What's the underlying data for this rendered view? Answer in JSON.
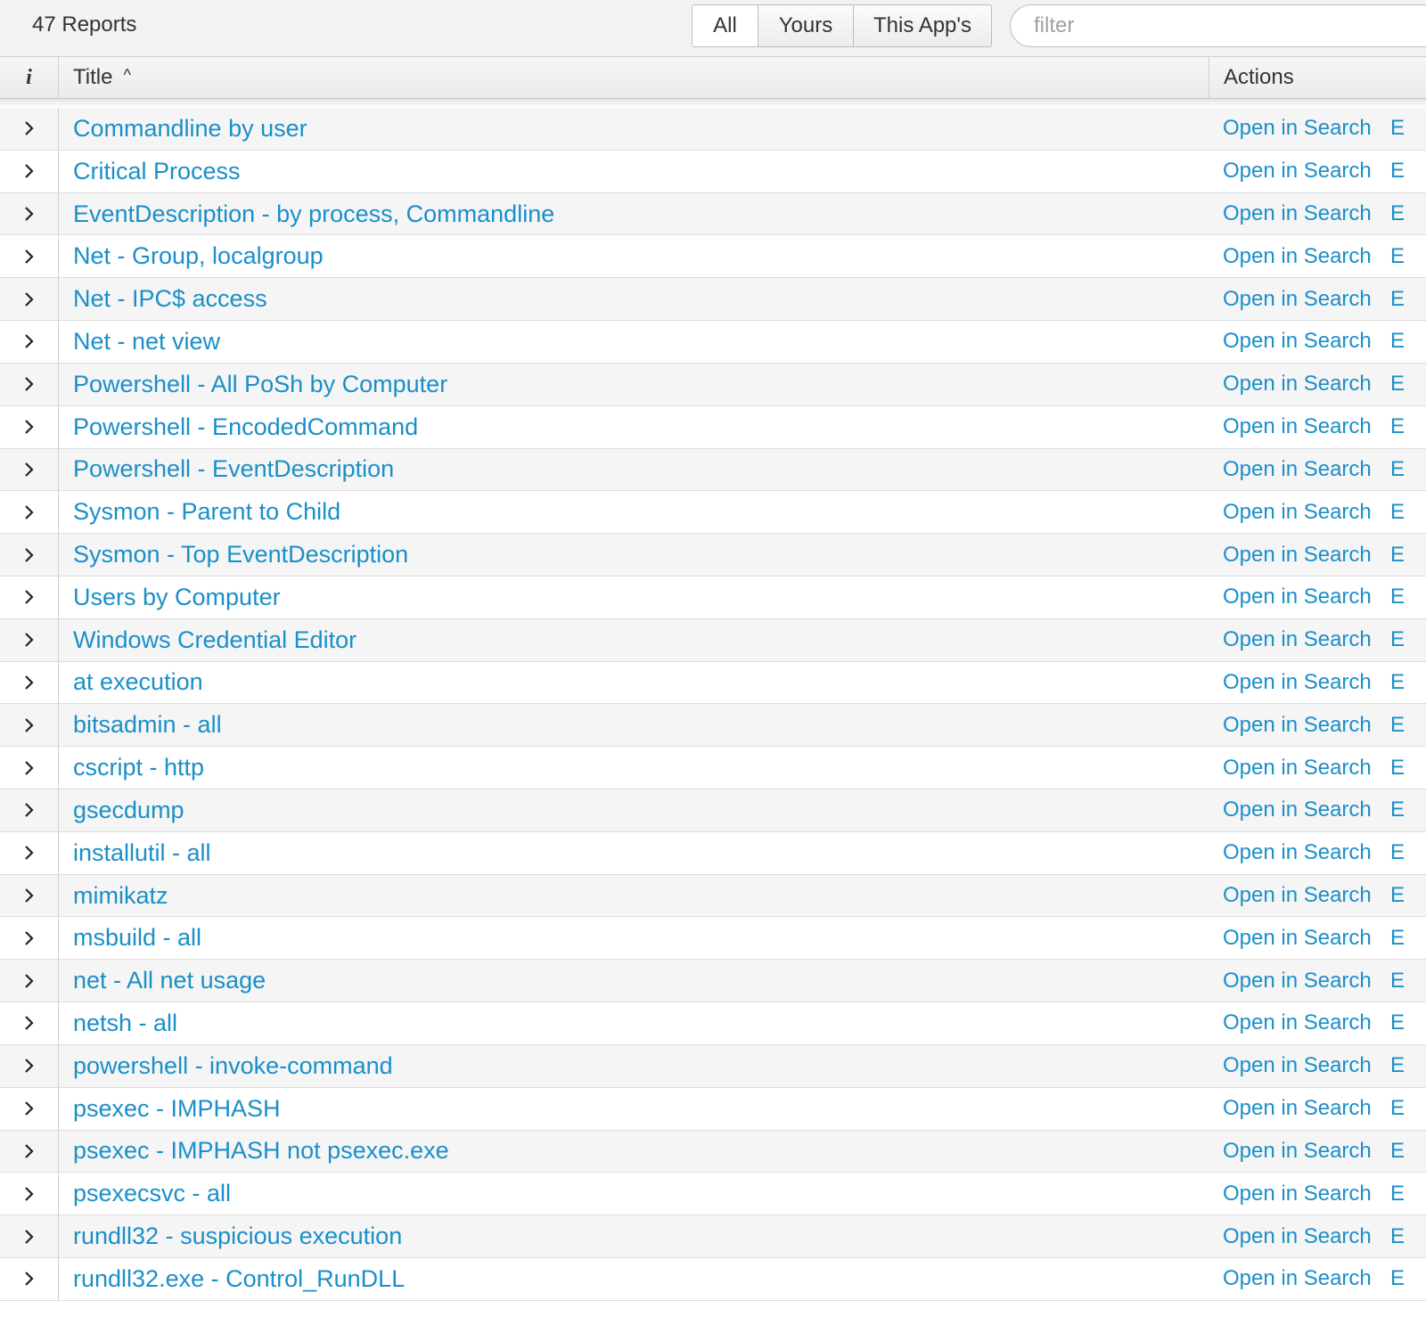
{
  "toolbar": {
    "count_label": "47 Reports",
    "filters": [
      {
        "label": "All",
        "active": true
      },
      {
        "label": "Yours",
        "active": false
      },
      {
        "label": "This App's",
        "active": false
      }
    ],
    "filter_placeholder": "filter"
  },
  "table": {
    "headers": {
      "info": "i",
      "title": "Title",
      "title_sort_icon": "^",
      "actions": "Actions"
    },
    "open_label": "Open in Search",
    "edit_label": "E",
    "rows": [
      "Commandline by user",
      "Critical Process",
      "EventDescription - by process, Commandline",
      "Net - Group, localgroup",
      "Net - IPC$ access",
      "Net - net view",
      "Powershell - All PoSh by Computer",
      "Powershell - EncodedCommand",
      "Powershell - EventDescription",
      "Sysmon - Parent to Child",
      "Sysmon - Top EventDescription",
      "Users by Computer",
      "Windows Credential Editor",
      "at execution",
      "bitsadmin - all",
      "cscript - http",
      "gsecdump",
      "installutil - all",
      "mimikatz",
      "msbuild - all",
      "net - All net usage",
      "netsh - all",
      "powershell - invoke-command",
      "psexec - IMPHASH",
      "psexec - IMPHASH not psexec.exe",
      "psexecsvc - all",
      "rundll32 - suspicious execution",
      "rundll32.exe - Control_RunDLL"
    ]
  },
  "colors": {
    "link": "#1a8fc9",
    "toolbar_bg": "#f2f2f2",
    "row_alt": "#f5f5f5"
  },
  "icons": {
    "expand": "chevron-right-icon",
    "sort": "sort-ascending-icon",
    "info": "info-icon"
  }
}
